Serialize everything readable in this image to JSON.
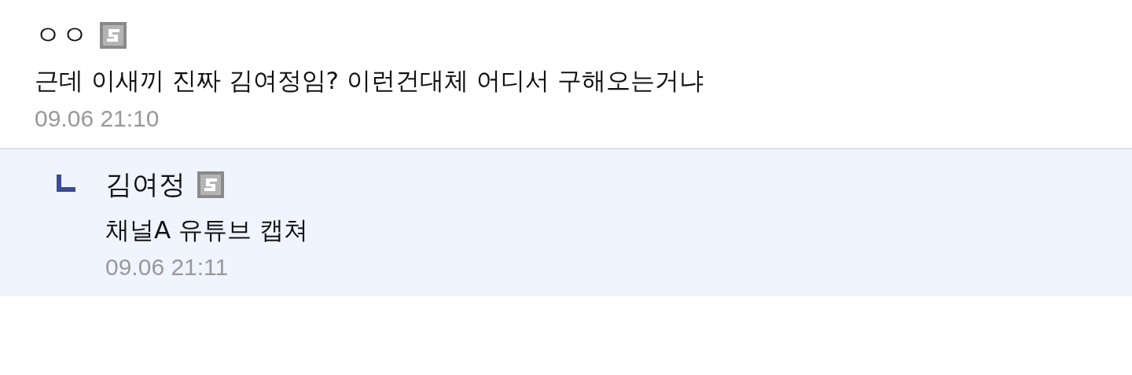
{
  "comments": [
    {
      "author": "ㅇㅇ",
      "text": "근데 이새끼 진짜 김여정임? 이런건대체 어디서 구해오는거냐",
      "time": "09.06 21:10",
      "replies": [
        {
          "author": "김여정",
          "text": "채널A 유튜브 캡쳐",
          "time": "09.06 21:11"
        }
      ]
    }
  ]
}
